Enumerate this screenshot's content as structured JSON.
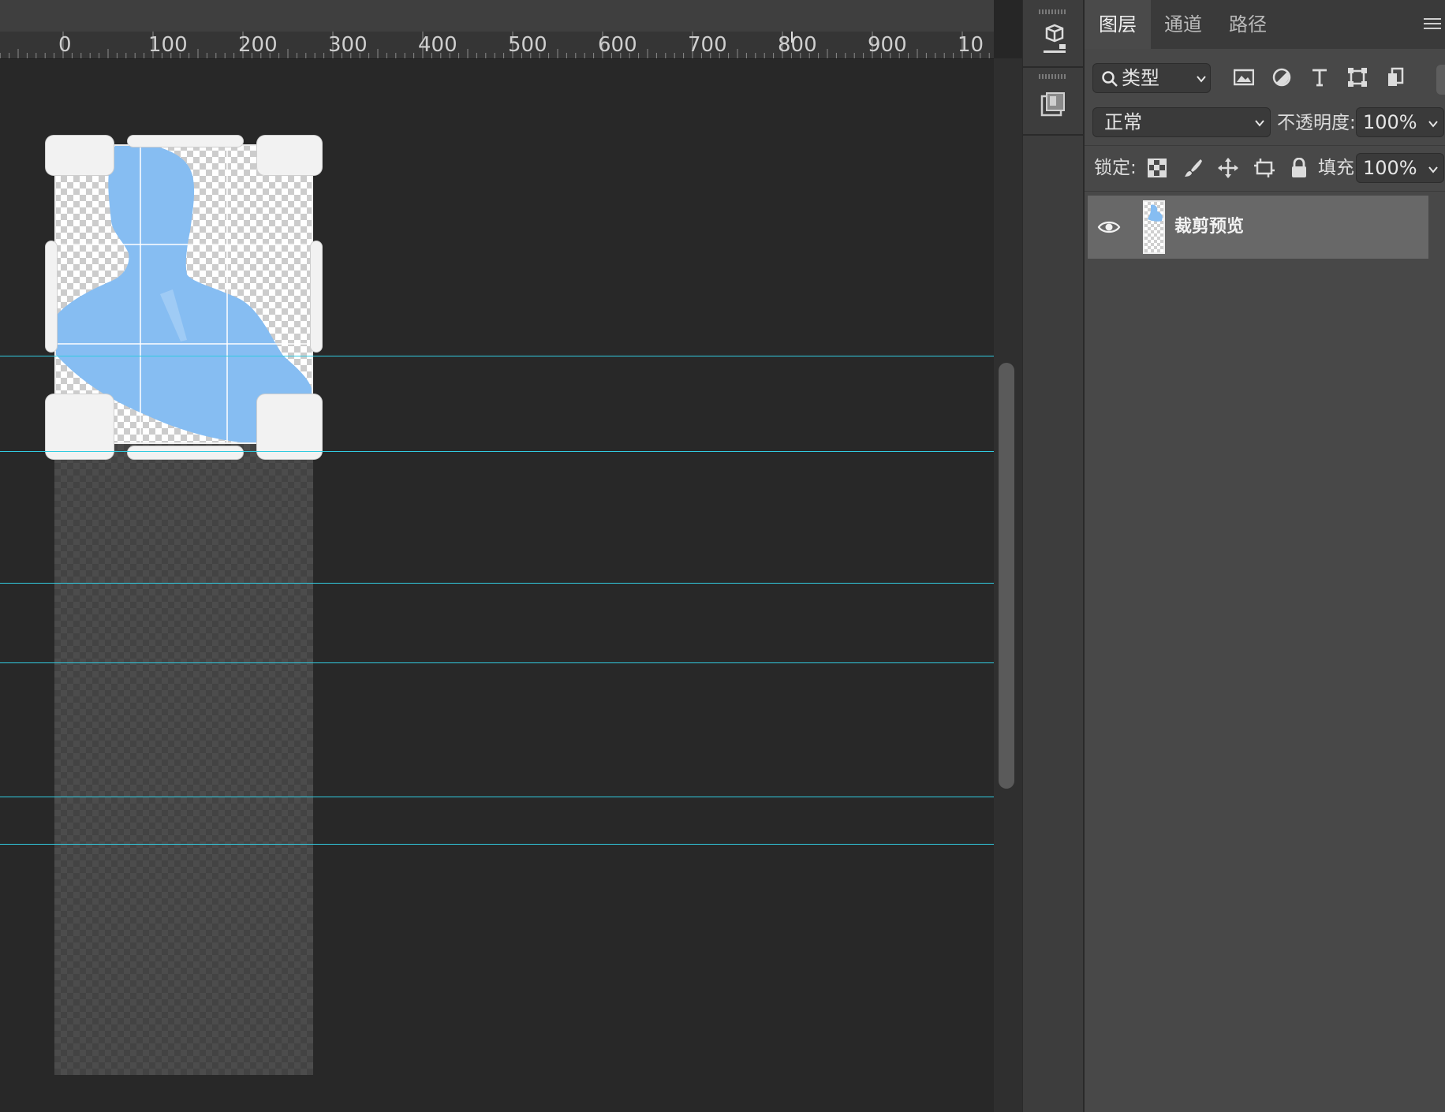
{
  "ruler": {
    "labels": [
      "0",
      "100",
      "200",
      "300",
      "400",
      "500",
      "600",
      "700",
      "800",
      "900",
      "10"
    ]
  },
  "panel": {
    "tabs": [
      {
        "label": "图层"
      },
      {
        "label": "通道"
      },
      {
        "label": "路径"
      }
    ],
    "filter": {
      "kind_label": "类型",
      "icons": [
        "image-filter-icon",
        "adjustment-filter-icon",
        "type-filter-icon",
        "shape-filter-icon",
        "smart-object-filter-icon"
      ]
    },
    "blend_mode": "正常",
    "opacity_label": "不透明度:",
    "opacity_value": "100%",
    "lock_label": "锁定:",
    "fill_label": "填充:",
    "fill_value": "100%",
    "layers": [
      {
        "name": "裁剪预览",
        "visible": true
      }
    ]
  },
  "colors": {
    "guide": "#31cbe0",
    "silhouette": "#86bdf2",
    "selected_layer": "#686868"
  }
}
